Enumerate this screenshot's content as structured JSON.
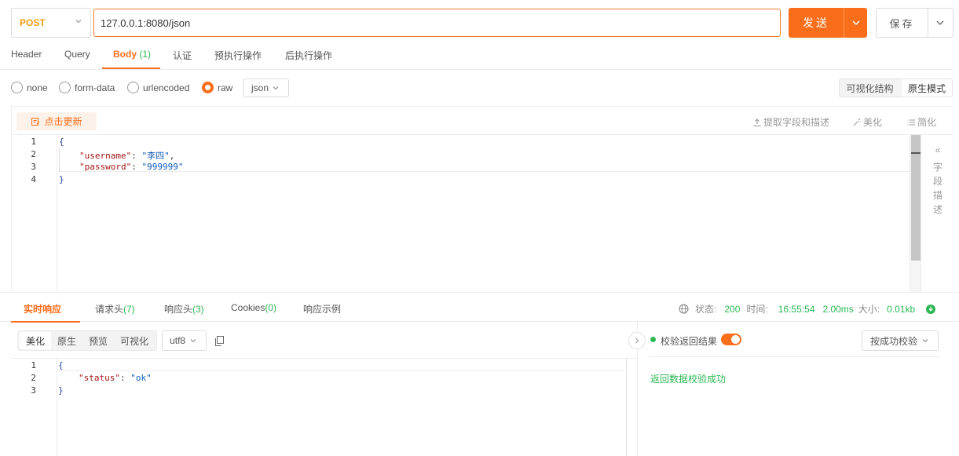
{
  "request": {
    "method": "POST",
    "url": "127.0.0.1:8080/json",
    "send_label": "发送",
    "save_label": "保存"
  },
  "req_tabs": [
    {
      "label": "Header"
    },
    {
      "label": "Query"
    },
    {
      "label": "Body",
      "count": "(1)"
    },
    {
      "label": "认证"
    },
    {
      "label": "预执行操作"
    },
    {
      "label": "后执行操作"
    }
  ],
  "body_types": [
    "none",
    "form-data",
    "urlencoded",
    "raw"
  ],
  "selected_body_type": "raw",
  "format_select": "json",
  "view_modes": [
    "可视化结构",
    "原生模式"
  ],
  "active_view_mode": "原生模式",
  "editor_toolbar": {
    "refresh": "点击更新",
    "extract": "提取字段和描述",
    "beautify": "美化",
    "simplify": "简化"
  },
  "field_desc": "字段描述",
  "request_body": {
    "line_numbers": [
      "1",
      "2",
      "3",
      "4"
    ],
    "open": "{",
    "key1": "\"username\"",
    "val1": "\"李四\"",
    "key2": "\"password\"",
    "val2": "\"999999\"",
    "close": "}"
  },
  "resp_tabs": [
    {
      "label": "实时响应"
    },
    {
      "label": "请求头",
      "count": "(7)"
    },
    {
      "label": "响应头",
      "count": "(3)"
    },
    {
      "label": "Cookies",
      "count": "(0)"
    },
    {
      "label": "响应示例"
    }
  ],
  "stats": {
    "status_label": "状态:",
    "status": "200",
    "time_label": "时间:",
    "time": "16:55:54",
    "duration": "2.00ms",
    "size_label": "大小:",
    "size": "0.01kb"
  },
  "resp_formats": [
    "美化",
    "原生",
    "预览",
    "可视化"
  ],
  "active_resp_format": "美化",
  "encoding": "utf8",
  "response_body": {
    "line_numbers": [
      "1",
      "2",
      "3"
    ],
    "open": "{",
    "key1": "\"status\"",
    "val1": "\"ok\"",
    "close": "}"
  },
  "verify": {
    "label": "校验返回结果",
    "enabled": true,
    "mode": "按成功校验",
    "result": "返回数据校验成功"
  },
  "colors": {
    "accent": "#fa6d1a",
    "success": "#2db853",
    "method": "#f39c12"
  }
}
